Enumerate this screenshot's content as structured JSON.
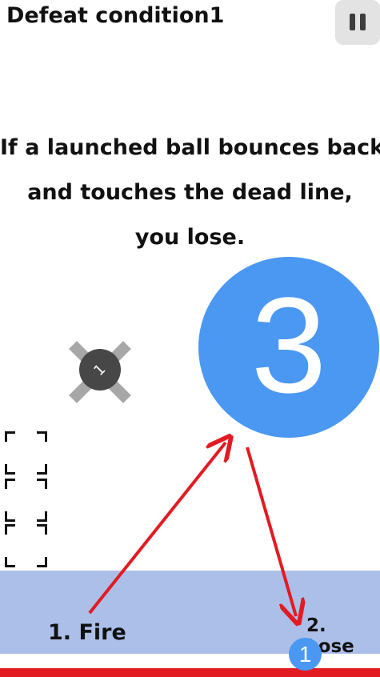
{
  "header": {
    "title": "Defeat condition1",
    "pause_icon": "pause-icon"
  },
  "instruction": {
    "lines": [
      "If a launched ball bounces back",
      "and touches the dead line,",
      "you lose."
    ]
  },
  "game": {
    "big_ball_value": "3",
    "obstacle_value": "1",
    "launcher_value": "1",
    "empty_slots": 3,
    "labels": {
      "fire": "1. Fire",
      "lose": "2. Lose"
    },
    "colors": {
      "ball": "#4a98f2",
      "launch_zone": "#abbfe8",
      "dead_line": "#e21b22",
      "arrow": "#e21b22",
      "obstacle_hub": "#474747",
      "obstacle_arms": "#a7a7a7"
    }
  }
}
